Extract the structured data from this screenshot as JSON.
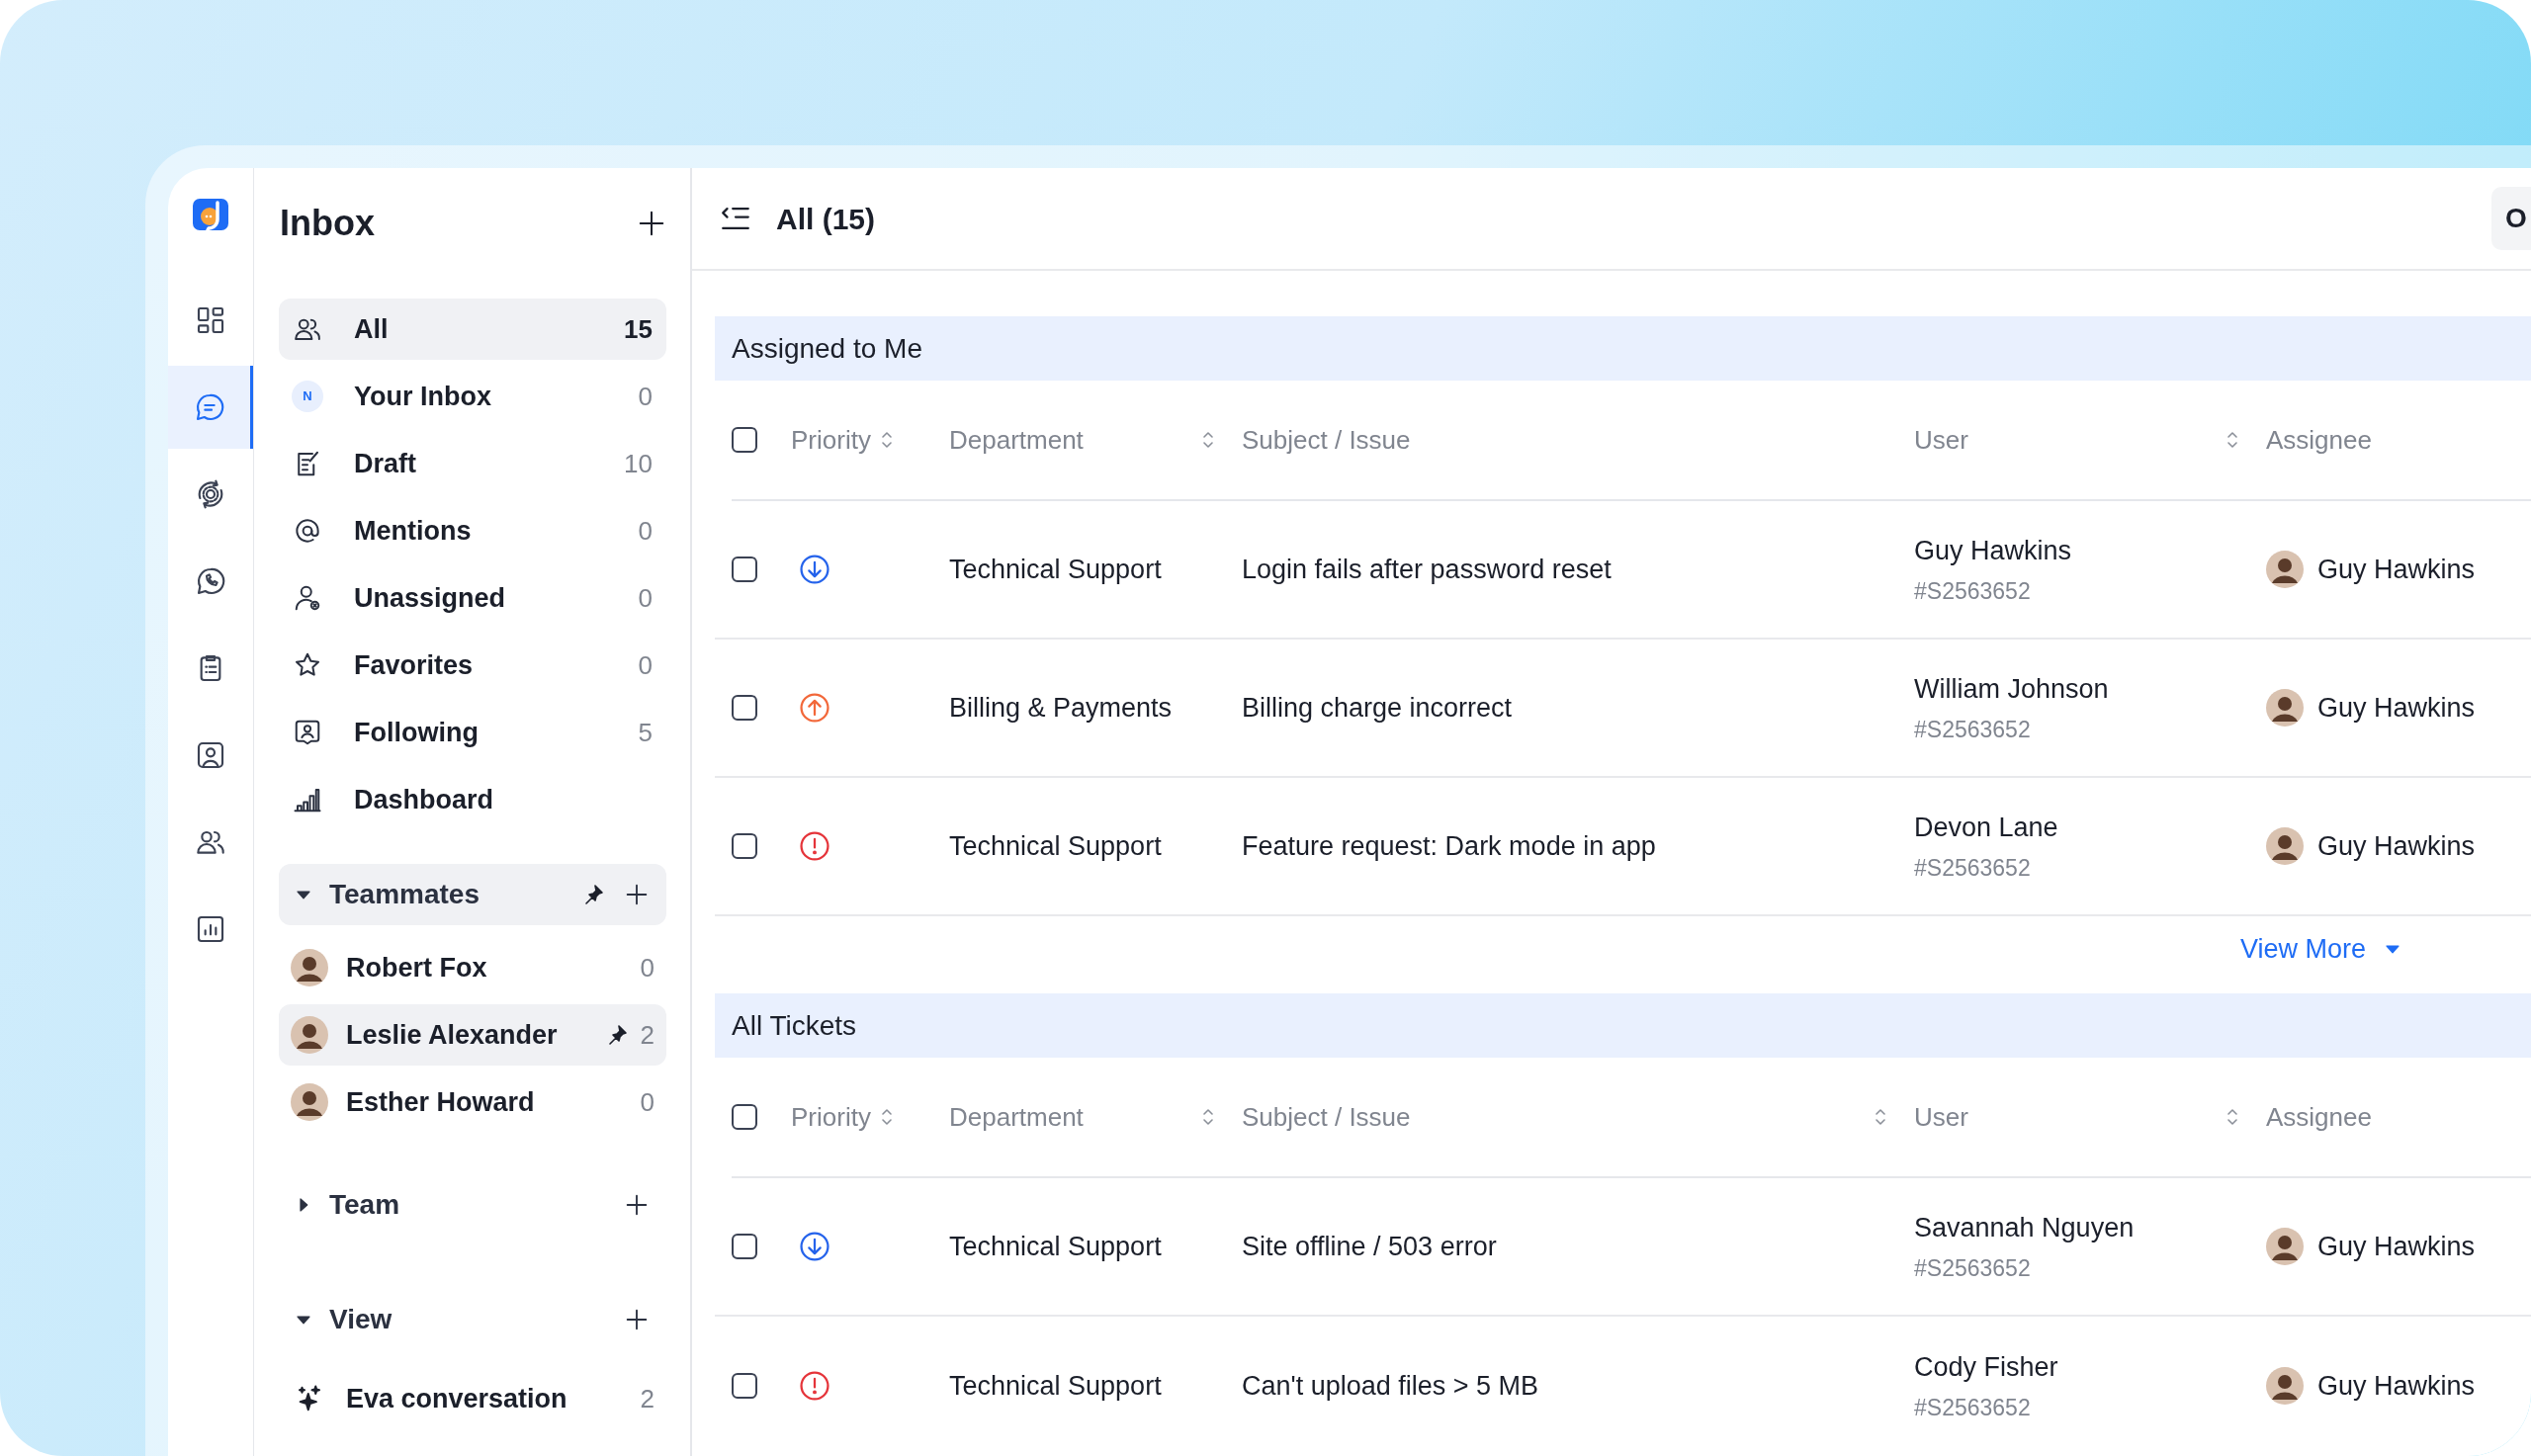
{
  "rail": {
    "items": [
      {
        "selected": false
      },
      {
        "selected": true
      },
      {
        "selected": false
      },
      {
        "selected": false
      },
      {
        "selected": false
      },
      {
        "selected": false
      },
      {
        "selected": false
      },
      {
        "selected": false
      }
    ]
  },
  "sidebar": {
    "title": "Inbox",
    "items": [
      {
        "label": "All",
        "count": "15",
        "selected": true
      },
      {
        "label": "Your Inbox",
        "count": "0",
        "selected": false,
        "badge": "N"
      },
      {
        "label": "Draft",
        "count": "10",
        "selected": false
      },
      {
        "label": "Mentions",
        "count": "0",
        "selected": false
      },
      {
        "label": "Unassigned",
        "count": "0",
        "selected": false
      },
      {
        "label": "Favorites",
        "count": "0",
        "selected": false
      },
      {
        "label": "Following",
        "count": "5",
        "selected": false
      },
      {
        "label": "Dashboard",
        "selected": false
      }
    ],
    "sections": [
      {
        "title": "Teammates",
        "expanded": true,
        "selected": true,
        "pinned": true,
        "items": [
          {
            "label": "Robert Fox",
            "count": "0",
            "selected": false,
            "pinned": false
          },
          {
            "label": "Leslie Alexander",
            "count": "2",
            "selected": true,
            "pinned": true
          },
          {
            "label": "Esther Howard",
            "count": "0",
            "selected": false,
            "pinned": false
          }
        ]
      },
      {
        "title": "Team",
        "expanded": false,
        "selected": false,
        "pinned": false
      },
      {
        "title": "View",
        "expanded": true,
        "selected": false,
        "pinned": false,
        "items": [
          {
            "label": "Eva conversation",
            "count": "2",
            "selected": false,
            "pinned": false
          }
        ]
      }
    ]
  },
  "main": {
    "title": "All (15)",
    "action_button": "O",
    "groups": [
      {
        "title": "Assigned to Me",
        "all_checked": false,
        "columns": [
          {
            "label": "Priority",
            "sortable": true
          },
          {
            "label": "Department",
            "sortable": true
          },
          {
            "label": "Subject / Issue",
            "sortable": false
          },
          {
            "label": "User",
            "sortable": true
          },
          {
            "label": "Assignee",
            "sortable": false
          }
        ],
        "rows": [
          {
            "checked": false,
            "kind": "low",
            "department": "Technical Support",
            "subject": "Login fails after password reset",
            "user": "Guy Hawkins",
            "ticket": "#S2563652",
            "assignee": "Guy Hawkins"
          },
          {
            "checked": false,
            "kind": "high",
            "department": "Billing & Payments",
            "subject": "Billing charge incorrect",
            "user": "William Johnson",
            "ticket": "#S2563652",
            "assignee": "Guy Hawkins"
          },
          {
            "checked": false,
            "kind": "urgent",
            "department": "Technical Support",
            "subject": "Feature request: Dark mode in app",
            "user": "Devon Lane",
            "ticket": "#S2563652",
            "assignee": "Guy Hawkins"
          }
        ],
        "view_more": "View More"
      },
      {
        "title": "All Tickets",
        "all_checked": false,
        "columns": [
          {
            "label": "Priority",
            "sortable": true
          },
          {
            "label": "Department",
            "sortable": true
          },
          {
            "label": "Subject / Issue",
            "sortable": true
          },
          {
            "label": "User",
            "sortable": true
          },
          {
            "label": "Assignee",
            "sortable": false
          }
        ],
        "rows": [
          {
            "checked": false,
            "kind": "low",
            "department": "Technical Support",
            "subject": "Site offline / 503 error",
            "user": "Savannah Nguyen",
            "ticket": "#S2563652",
            "assignee": "Guy Hawkins"
          },
          {
            "checked": false,
            "kind": "urgent",
            "department": "Technical Support",
            "subject": "Can't upload files > 5 MB",
            "user": "Cody Fisher",
            "ticket": "#S2563652",
            "assignee": "Guy Hawkins"
          }
        ]
      }
    ]
  }
}
